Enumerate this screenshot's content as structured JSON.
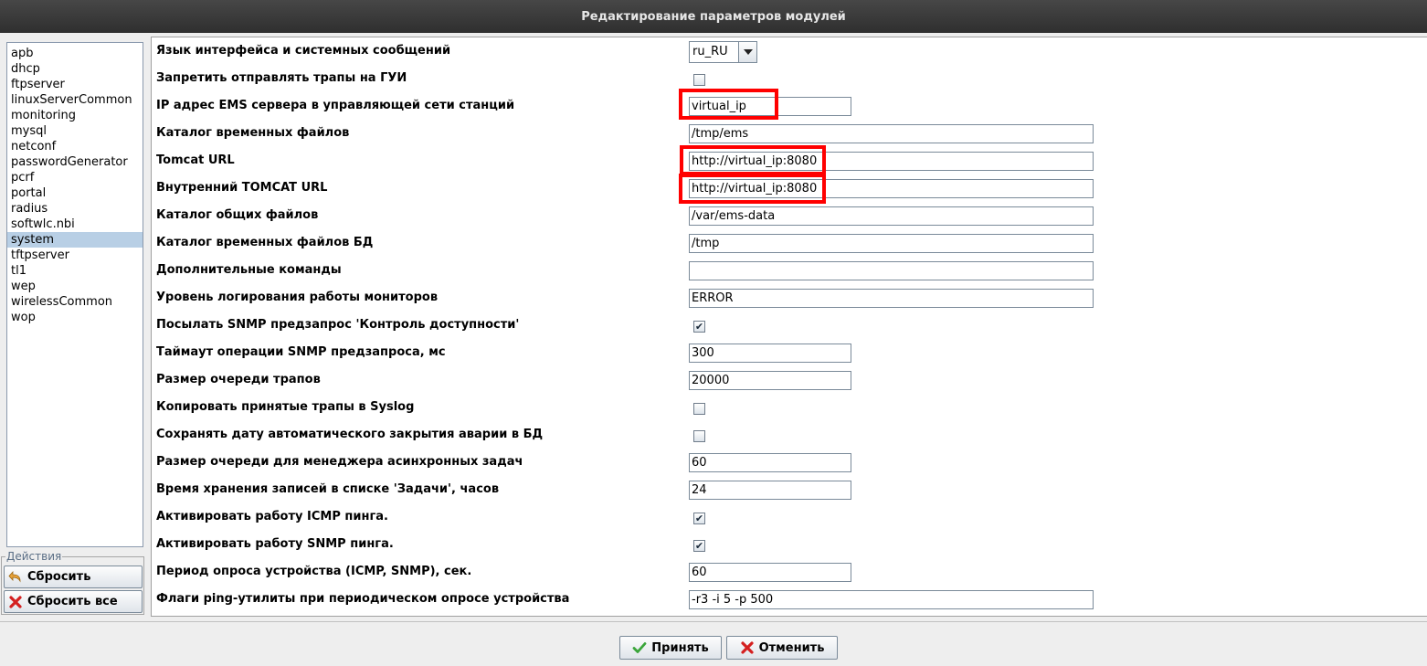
{
  "window": {
    "title": "Редактирование параметров модулей"
  },
  "modules": {
    "items": [
      "apb",
      "dhcp",
      "ftpserver",
      "linuxServerCommon",
      "monitoring",
      "mysql",
      "netconf",
      "passwordGenerator",
      "pcrf",
      "portal",
      "radius",
      "softwlc.nbi",
      "system",
      "tftpserver",
      "tl1",
      "wep",
      "wirelessCommon",
      "wop"
    ],
    "selected": "system"
  },
  "actions": {
    "legend": "Действия",
    "reset_label": "Сбросить",
    "reset_all_label": "Сбросить все"
  },
  "settings": {
    "rows": [
      {
        "label": "Язык интерфейса и системных сообщений",
        "type": "combo",
        "value": "ru_RU"
      },
      {
        "label": "Запретить отправлять трапы на ГУИ",
        "type": "checkbox",
        "checked": false
      },
      {
        "label": "IP адрес EMS сервера в управляющей сети станций",
        "type": "short",
        "value": "virtual_ip"
      },
      {
        "label": "Каталог временных файлов",
        "type": "long",
        "value": "/tmp/ems"
      },
      {
        "label": "Tomcat URL",
        "type": "long",
        "value": "http://virtual_ip:8080"
      },
      {
        "label": "Внутренний TOMCAT URL",
        "type": "long",
        "value": "http://virtual_ip:8080"
      },
      {
        "label": "Каталог общих файлов",
        "type": "long",
        "value": "/var/ems-data"
      },
      {
        "label": "Каталог временных файлов БД",
        "type": "long",
        "value": "/tmp"
      },
      {
        "label": "Дополнительные команды",
        "type": "long",
        "value": ""
      },
      {
        "label": "Уровень логирования работы мониторов",
        "type": "long",
        "value": "ERROR"
      },
      {
        "label": "Посылать SNMP предзапрос 'Контроль доступности'",
        "type": "checkbox",
        "checked": true
      },
      {
        "label": "Таймаут операции SNMP предзапроса, мс",
        "type": "short",
        "value": "300"
      },
      {
        "label": "Размер очереди трапов",
        "type": "short",
        "value": "20000"
      },
      {
        "label": "Копировать принятые трапы в Syslog",
        "type": "checkbox",
        "checked": false
      },
      {
        "label": "Сохранять дату автоматического закрытия аварии в БД",
        "type": "checkbox",
        "checked": false
      },
      {
        "label": "Размер очереди для менеджера асинхронных задач",
        "type": "short",
        "value": "60"
      },
      {
        "label": "Время хранения записей в списке 'Задачи', часов",
        "type": "short",
        "value": "24"
      },
      {
        "label": "Активировать работу ICMP пинга.",
        "type": "checkbox",
        "checked": true
      },
      {
        "label": "Активировать работу SNMP пинга.",
        "type": "checkbox",
        "checked": true
      },
      {
        "label": "Период опроса устройства (ICMP, SNMP), сек.",
        "type": "short",
        "value": "60"
      },
      {
        "label": "Флаги ping-утилиты при периодическом опросе устройства",
        "type": "long",
        "value": "-r3 -i 5 -p 500"
      }
    ]
  },
  "footer": {
    "accept_label": "Принять",
    "cancel_label": "Отменить"
  },
  "colors": {
    "highlight": "#ff0000",
    "selection": "#b8cfe5",
    "titlebar": "#3a3a3a"
  }
}
